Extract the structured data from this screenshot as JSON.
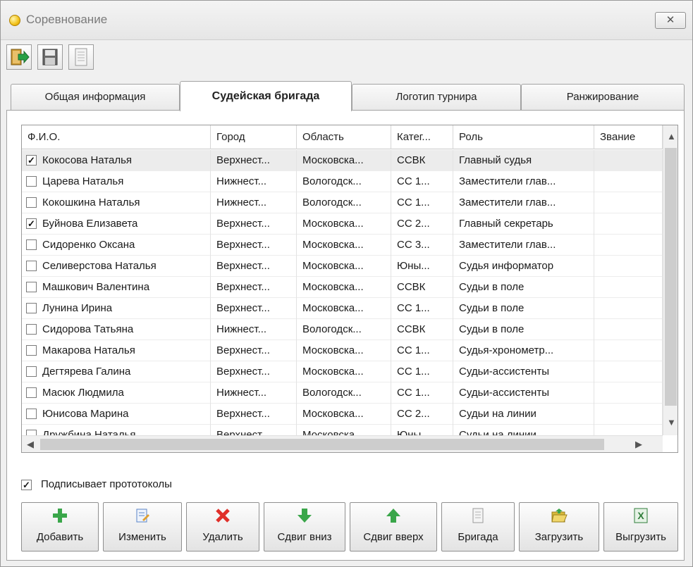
{
  "window": {
    "title": "Соревнование",
    "close_glyph": "✕"
  },
  "toolbar": {
    "icons": [
      "exit-icon",
      "save-icon",
      "document-icon"
    ]
  },
  "tabs": [
    {
      "label": "Общая информация",
      "active": false
    },
    {
      "label": "Судейская бригада",
      "active": true
    },
    {
      "label": "Логотип турнира",
      "active": false
    },
    {
      "label": "Ранжирование",
      "active": false
    }
  ],
  "table": {
    "columns": [
      "Ф.И.О.",
      "Город",
      "Область",
      "Катег...",
      "Роль",
      "Звание"
    ],
    "rows": [
      {
        "checked": true,
        "name": "Кокосова Наталья",
        "city": "Верхнест...",
        "region": "Московска...",
        "category": "ССВК",
        "role": "Главный судья",
        "rank": ""
      },
      {
        "checked": false,
        "name": "Царева Наталья",
        "city": "Нижнест...",
        "region": "Вологодск...",
        "category": "СС 1...",
        "role": "Заместители глав...",
        "rank": ""
      },
      {
        "checked": false,
        "name": "Кокошкина Наталья",
        "city": "Нижнест...",
        "region": "Вологодск...",
        "category": "СС 1...",
        "role": "Заместители глав...",
        "rank": ""
      },
      {
        "checked": true,
        "name": "Буйнова Елизавета",
        "city": "Верхнест...",
        "region": "Московска...",
        "category": "СС 2...",
        "role": "Главный секретарь",
        "rank": ""
      },
      {
        "checked": false,
        "name": "Сидоренко Оксана",
        "city": "Верхнест...",
        "region": "Московска...",
        "category": "СС 3...",
        "role": "Заместители глав...",
        "rank": ""
      },
      {
        "checked": false,
        "name": "Селиверстова Наталья",
        "city": "Верхнест...",
        "region": "Московска...",
        "category": "Юны...",
        "role": "Судья информатор",
        "rank": ""
      },
      {
        "checked": false,
        "name": "Машкович Валентина",
        "city": "Верхнест...",
        "region": "Московска...",
        "category": "ССВК",
        "role": "Судьи в поле",
        "rank": ""
      },
      {
        "checked": false,
        "name": "Лунина Ирина",
        "city": "Верхнест...",
        "region": "Московска...",
        "category": "СС 1...",
        "role": "Судьи в поле",
        "rank": ""
      },
      {
        "checked": false,
        "name": "Сидорова Татьяна",
        "city": "Нижнест...",
        "region": "Вологодск...",
        "category": "ССВК",
        "role": "Судьи в поле",
        "rank": ""
      },
      {
        "checked": false,
        "name": "Макарова Наталья",
        "city": "Верхнест...",
        "region": "Московска...",
        "category": "СС 1...",
        "role": "Судья-хронометр...",
        "rank": ""
      },
      {
        "checked": false,
        "name": "Дегтярева Галина",
        "city": "Верхнест...",
        "region": "Московска...",
        "category": "СС 1...",
        "role": "Судьи-ассистенты",
        "rank": ""
      },
      {
        "checked": false,
        "name": "Масюк Людмила",
        "city": "Нижнест...",
        "region": "Вологодск...",
        "category": "СС 1...",
        "role": "Судьи-ассистенты",
        "rank": ""
      },
      {
        "checked": false,
        "name": "Юнисова Марина",
        "city": "Верхнест...",
        "region": "Московска...",
        "category": "СС 2...",
        "role": "Судьи на линии",
        "rank": ""
      },
      {
        "checked": false,
        "name": "Дружбина Наталья",
        "city": "Верхнест...",
        "region": "Московска...",
        "category": "Юны...",
        "role": "Судьи на линии",
        "rank": ""
      }
    ]
  },
  "sign_protocols": {
    "label": "Подписывает прототоколы",
    "checked": true
  },
  "buttons": [
    {
      "label": "Добавить",
      "icon": "plus-icon",
      "color": "#3aa64a"
    },
    {
      "label": "Изменить",
      "icon": "edit-icon",
      "color": "#5a84c8"
    },
    {
      "label": "Удалить",
      "icon": "delete-x-icon",
      "color": "#e0302a"
    },
    {
      "label": "Сдвиг вниз",
      "icon": "arrow-down-icon",
      "color": "#3aa64a"
    },
    {
      "label": "Сдвиг вверх",
      "icon": "arrow-up-icon",
      "color": "#3aa64a"
    },
    {
      "label": "Бригада",
      "icon": "document-icon",
      "color": "#9a9a9a"
    },
    {
      "label": "Загрузить",
      "icon": "folder-open-icon",
      "color": "#d8b93a"
    },
    {
      "label": "Выгрузить",
      "icon": "excel-icon",
      "color": "#2f7d3a"
    }
  ]
}
